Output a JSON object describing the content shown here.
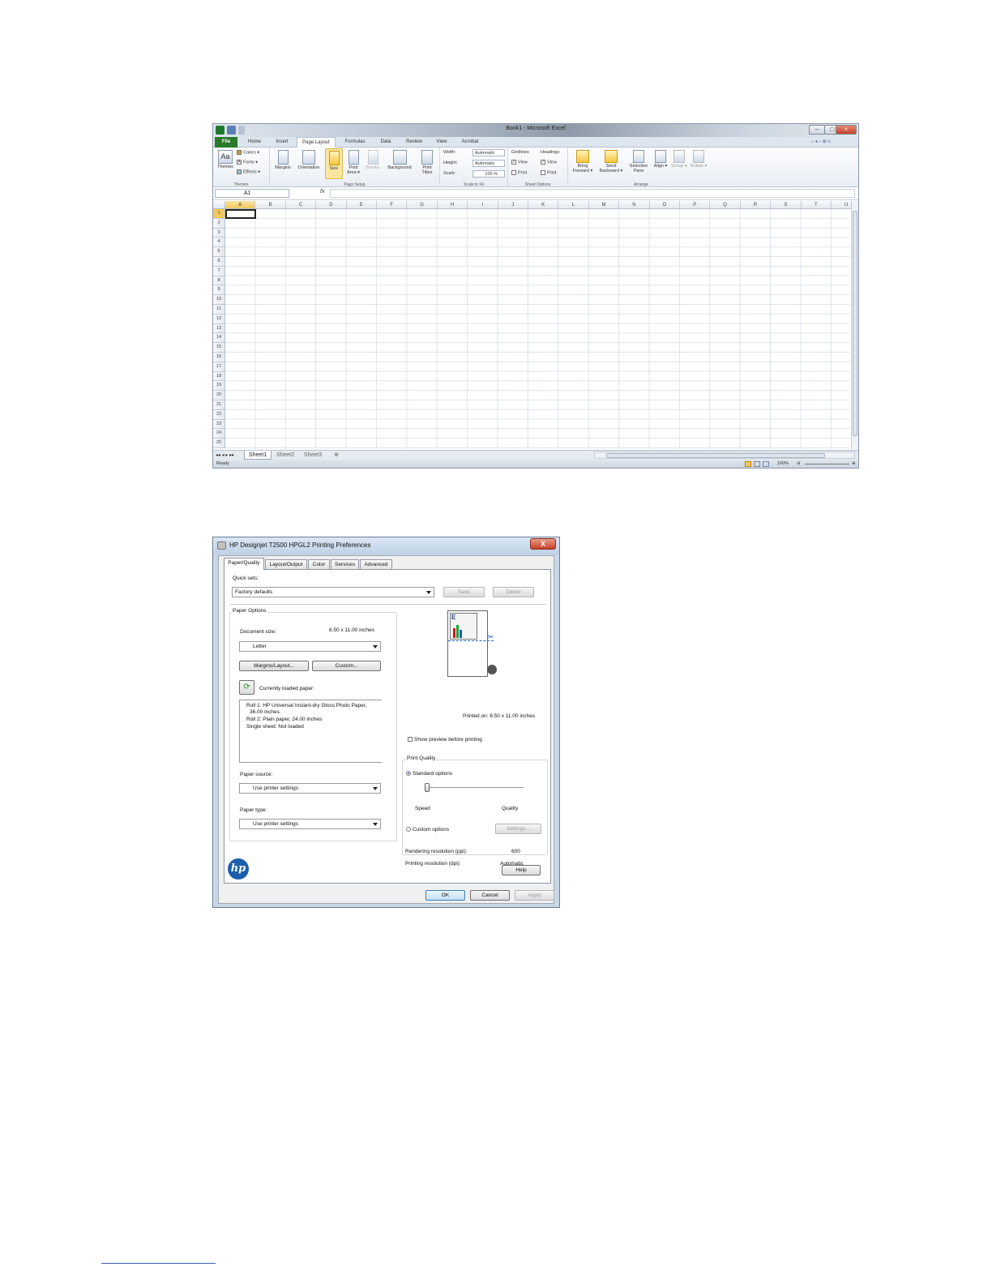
{
  "excel": {
    "window_title": "Book1 - Microsoft Excel",
    "tabs": [
      "File",
      "Home",
      "Insert",
      "Page Layout",
      "Formulas",
      "Data",
      "Review",
      "View",
      "Acrobat"
    ],
    "active_tab": "Page Layout",
    "ribbon": {
      "themes": {
        "themes": "Themes",
        "colors": "Colors ▾",
        "fonts": "Fonts ▾",
        "effects": "Effects ▾",
        "group": "Themes"
      },
      "page_setup": {
        "margins": "Margins",
        "orientation": "Orientation",
        "size": "Size",
        "print_area": "Print Area ▾",
        "breaks": "Breaks",
        "background": "Background",
        "print_titles": "Print Titles",
        "group": "Page Setup"
      },
      "scale_to_fit": {
        "width_label": "Width:",
        "width_value": "Automatic",
        "height_label": "Height:",
        "height_value": "Automatic",
        "scale_label": "Scale:",
        "scale_value": "100 %",
        "group": "Scale to Fit"
      },
      "sheet_options": {
        "gridlines": "Gridlines",
        "headings": "Headings",
        "view": "View",
        "print": "Print",
        "group": "Sheet Options"
      },
      "arrange": {
        "bring_forward": "Bring Forward ▾",
        "send_backward": "Send Backward ▾",
        "selection_pane": "Selection Pane",
        "align": "Align ▾",
        "group_btn": "Group ▾",
        "rotate": "Rotate ▾",
        "group": "Arrange"
      }
    },
    "name_box": "A1",
    "fx": "fx",
    "columns": [
      "A",
      "B",
      "C",
      "D",
      "E",
      "F",
      "G",
      "H",
      "I",
      "J",
      "K",
      "L",
      "M",
      "N",
      "O",
      "P",
      "Q",
      "R",
      "S",
      "T",
      "U"
    ],
    "rows": [
      "1",
      "2",
      "3",
      "4",
      "5",
      "6",
      "7",
      "8",
      "9",
      "10",
      "11",
      "12",
      "13",
      "14",
      "15",
      "16",
      "17",
      "18",
      "19",
      "20",
      "21",
      "22",
      "23",
      "24",
      "25"
    ],
    "sheets": [
      "Sheet1",
      "Sheet2",
      "Sheet3"
    ],
    "status": "Ready",
    "zoom": "100%"
  },
  "hp": {
    "title": "HP Designjet T2500 HPGL2 Printing Preferences",
    "close": "X",
    "tabs": [
      "Paper/Quality",
      "Layout/Output",
      "Color",
      "Services",
      "Advanced"
    ],
    "quick_sets_label": "Quick sets:",
    "quick_sets_value": "Factory defaults",
    "save": "Save",
    "delete": "Delete",
    "paper_options": "Paper Options",
    "document_size_label": "Document size:",
    "document_size_value": "8.50 x 11.00 inches",
    "document_size_select": "Letter",
    "margins_layout": "Margins/Layout...",
    "custom": "Custom...",
    "currently_loaded": "Currently loaded paper:",
    "loaded_list": [
      "Roll 1: HP Universal Instant-dry Gloss Photo Paper,",
      "36.00 inches",
      "Roll 2: Plain paper, 24.00 inches",
      "Single sheet: Not loaded"
    ],
    "paper_source_label": "Paper source:",
    "paper_source_value": "Use printer settings",
    "paper_type_label": "Paper type:",
    "paper_type_value": "Use printer settings",
    "printed_on": "Printed on: 8.50 x 11.00 inches",
    "show_preview": "Show preview before printing",
    "print_quality": "Print Quality",
    "standard_options": "Standard options",
    "speed": "Speed",
    "quality": "Quality",
    "custom_options": "Custom options",
    "settings": "Settings...",
    "rendering_label": "Rendering resolution (ppi):",
    "rendering_value": "600",
    "printing_label": "Printing resolution (dpi):",
    "printing_value": "Automatic",
    "help": "Help",
    "ok": "OK",
    "cancel": "Cancel",
    "apply": "Apply",
    "logo": "hp"
  }
}
